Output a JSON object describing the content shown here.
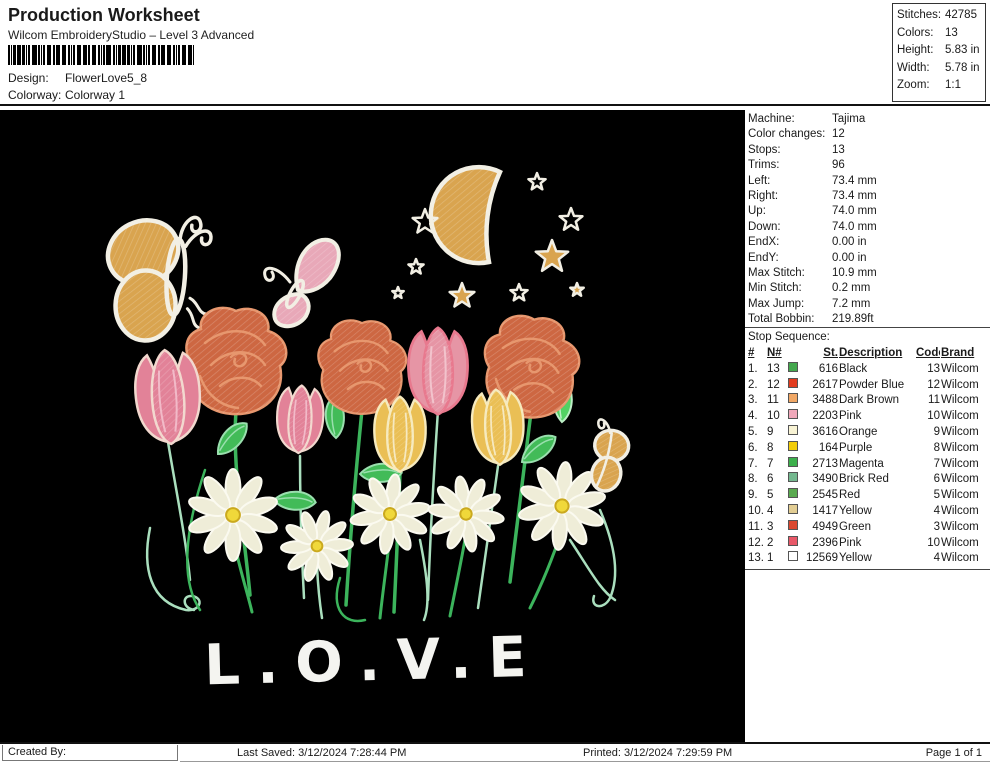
{
  "header": {
    "title": "Production Worksheet",
    "subtitle": "Wilcom EmbroideryStudio – Level 3 Advanced",
    "design_label": "Design:",
    "design_value": "FlowerLove5_8",
    "colorway_label": "Colorway:",
    "colorway_value": "Colorway 1",
    "stats": [
      {
        "label": "Stitches:",
        "value": "42785"
      },
      {
        "label": "Colors:",
        "value": "13"
      },
      {
        "label": "Height:",
        "value": "5.83 in"
      },
      {
        "label": "Width:",
        "value": "5.78 in"
      },
      {
        "label": "Zoom:",
        "value": "1:1"
      }
    ]
  },
  "machine_info": [
    {
      "label": "Machine:",
      "value": "Tajima"
    },
    {
      "label": "Color changes:",
      "value": "12"
    },
    {
      "label": "Stops:",
      "value": "13"
    },
    {
      "label": "Trims:",
      "value": "96"
    },
    {
      "label": "Left:",
      "value": "73.4 mm"
    },
    {
      "label": "Right:",
      "value": "73.4 mm"
    },
    {
      "label": "Up:",
      "value": "74.0 mm"
    },
    {
      "label": "Down:",
      "value": "74.0 mm"
    },
    {
      "label": "EndX:",
      "value": "0.00 in"
    },
    {
      "label": "EndY:",
      "value": "0.00 in"
    },
    {
      "label": "Max Stitch:",
      "value": "10.9 mm"
    },
    {
      "label": "Min Stitch:",
      "value": "0.2 mm"
    },
    {
      "label": "Max Jump:",
      "value": "7.2 mm"
    },
    {
      "label": "Total Bobbin:",
      "value": "219.89ft"
    }
  ],
  "stop_sequence": {
    "title": "Stop Sequence:",
    "columns": [
      "#",
      "N#",
      "St.",
      "Description",
      "Code",
      "Brand"
    ],
    "rows": [
      {
        "num": "1.",
        "n": "13",
        "swatch": "#44a84e",
        "st": "616",
        "description": "Black",
        "code": "13",
        "brand": "Wilcom"
      },
      {
        "num": "2.",
        "n": "12",
        "swatch": "#e23c1f",
        "st": "2617",
        "description": "Powder Blue",
        "code": "12",
        "brand": "Wilcom"
      },
      {
        "num": "3.",
        "n": "11",
        "swatch": "#f0a765",
        "st": "3488",
        "description": "Dark Brown",
        "code": "11",
        "brand": "Wilcom"
      },
      {
        "num": "4.",
        "n": "10",
        "swatch": "#f0a8ba",
        "st": "2203",
        "description": "Pink",
        "code": "10",
        "brand": "Wilcom"
      },
      {
        "num": "5.",
        "n": "9",
        "swatch": "#f8f3d4",
        "st": "3616",
        "description": "Orange",
        "code": "9",
        "brand": "Wilcom"
      },
      {
        "num": "6.",
        "n": "8",
        "swatch": "#f2cd0a",
        "st": "164",
        "description": "Purple",
        "code": "8",
        "brand": "Wilcom"
      },
      {
        "num": "7.",
        "n": "7",
        "swatch": "#3cb04c",
        "st": "2713",
        "description": "Magenta",
        "code": "7",
        "brand": "Wilcom"
      },
      {
        "num": "8.",
        "n": "6",
        "swatch": "#74b88f",
        "st": "3490",
        "description": "Brick Red",
        "code": "6",
        "brand": "Wilcom"
      },
      {
        "num": "9.",
        "n": "5",
        "swatch": "#5aaa50",
        "st": "2545",
        "description": "Red",
        "code": "5",
        "brand": "Wilcom"
      },
      {
        "num": "10.",
        "n": "4",
        "swatch": "#e2cd93",
        "st": "1417",
        "description": "Yellow",
        "code": "4",
        "brand": "Wilcom"
      },
      {
        "num": "11.",
        "n": "3",
        "swatch": "#da4830",
        "st": "4949",
        "description": "Green",
        "code": "3",
        "brand": "Wilcom"
      },
      {
        "num": "12.",
        "n": "2",
        "swatch": "#e85868",
        "st": "2396",
        "description": "Pink",
        "code": "10",
        "brand": "Wilcom"
      },
      {
        "num": "13.",
        "n": "1",
        "swatch": "#ffffff",
        "st": "12569",
        "description": "Yellow",
        "code": "4",
        "brand": "Wilcom"
      }
    ]
  },
  "design": {
    "love_text": "L.O.V.E",
    "palette": {
      "background": "#000000",
      "gold": "#d9a44f",
      "rose": "#cd6742",
      "rose_outline": "#e7976e",
      "pink": "#e28298",
      "mauve": "#e695a5",
      "yellow_tulip": "#eabf55",
      "daisy_petal": "#efedd8",
      "daisy_center": "#f0d83a",
      "stem_green": "#3cb45c",
      "stem_light": "#aadfbe",
      "outline_white": "#f2efe4"
    }
  },
  "footer": {
    "created_by": "Created By:",
    "last_saved": "Last Saved: 3/12/2024 7:28:44 PM",
    "printed": "Printed: 3/12/2024 7:29:59 PM",
    "page": "Page 1 of 1"
  }
}
